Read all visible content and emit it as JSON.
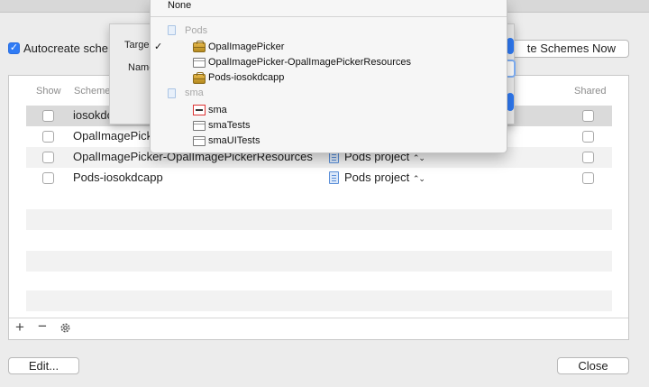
{
  "header": {
    "autocreate_label": "Autocreate sche",
    "autocreate_checked": true,
    "create_now_label": "te Schemes Now"
  },
  "table": {
    "columns": {
      "show": "Show",
      "scheme": "Scheme",
      "shared": "Shared"
    },
    "rows": [
      {
        "name": "iosokdc",
        "container": "",
        "show": false,
        "shared": false
      },
      {
        "name": "OpalImagePick",
        "container": "",
        "show": false,
        "shared": false
      },
      {
        "name": "OpalImagePicker-OpalImagePickerResources",
        "container": "Pods project",
        "show": false,
        "shared": false
      },
      {
        "name": "Pods-iosokdcapp",
        "container": "Pods project",
        "show": false,
        "shared": false
      }
    ],
    "updown": "⌃⌄"
  },
  "toolbar": {
    "add": "+",
    "remove": "−",
    "gear_icon": "gear-icon"
  },
  "sheet": {
    "target_label": "Targe",
    "name_label": "Name"
  },
  "menu": {
    "none": "None",
    "checkmark": "✓",
    "sections": [
      {
        "title": "Pods",
        "items": [
          {
            "label": "OpalImagePicker",
            "icon": "toolbox-icon"
          },
          {
            "label": "OpalImagePicker-OpalImagePickerResources",
            "icon": "bundle-icon"
          },
          {
            "label": "Pods-iosokdcapp",
            "icon": "toolbox-icon"
          }
        ]
      },
      {
        "title": "sma",
        "items": [
          {
            "label": "sma",
            "icon": "app-icon"
          },
          {
            "label": "smaTests",
            "icon": "bundle-icon"
          },
          {
            "label": "smaUITests",
            "icon": "bundle-icon"
          }
        ]
      }
    ]
  },
  "footer": {
    "edit_label": "Edit...",
    "close_label": "Close"
  },
  "colors": {
    "accent": "#2f7bf5",
    "stripe": "#f2f2f2",
    "selected_row": "#dadada"
  }
}
